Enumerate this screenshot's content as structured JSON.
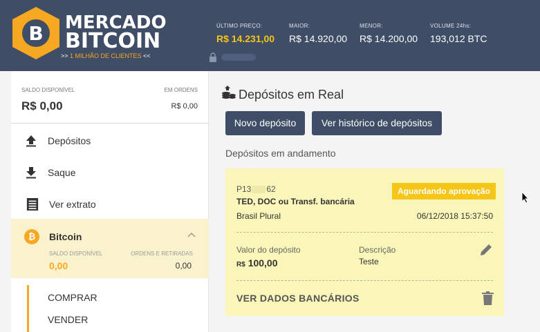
{
  "header": {
    "brand_line1": "MERCADO",
    "brand_line2": "BITCOIN",
    "tagline_prefix": ">> ",
    "tagline_highlight": "1 MILHÃO DE CLIENTES",
    "tagline_suffix": " <<",
    "stats": [
      {
        "label": "ÚLTIMO PREÇO:",
        "value": "R$ 14.231,00"
      },
      {
        "label": "MAIOR:",
        "value": "R$ 14.920,00"
      },
      {
        "label": "MENOR:",
        "value": "R$ 14.200,00"
      },
      {
        "label": "VOLUME 24hs:",
        "value": "193,012 BTC"
      }
    ]
  },
  "sidebar": {
    "balance_label": "SALDO DISPONÍVEL",
    "balance_value": "R$ 0,00",
    "orders_label": "EM ORDENS",
    "orders_value": "R$ 0,00",
    "menu": [
      {
        "label": "Depósitos",
        "icon": "upload-icon"
      },
      {
        "label": "Saque",
        "icon": "download-icon"
      },
      {
        "label": "Ver extrato",
        "icon": "statement-icon"
      }
    ],
    "bitcoin": {
      "name": "Bitcoin",
      "available_label": "SALDO DISPONÍVEL",
      "available_value": "0,00",
      "orders_label": "ORDENS E RETIRADAS",
      "orders_value": "0,00"
    },
    "sub_items": [
      "COMPRAR",
      "VENDER"
    ]
  },
  "main": {
    "title": "Depósitos em Real",
    "new_deposit_button": "Novo depósito",
    "history_button": "Ver histórico de depósitos",
    "in_progress_label": "Depósitos em andamento",
    "deposit": {
      "code_prefix": "P13",
      "code_suffix": "62",
      "status": "Aguardando aprovação",
      "method": "TED, DOC ou Transf. bancária",
      "bank": "Brasil Plural",
      "datetime": "06/12/2018 15:37:50",
      "value_label": "Valor do depósito",
      "currency": "R$",
      "value": "100,00",
      "description_label": "Descrição",
      "description": "Teste",
      "bank_data_link": "VER DADOS BANCÁRIOS"
    }
  },
  "colors": {
    "header_bg": "#3f4d66",
    "accent_orange": "#f7a823",
    "price_gold": "#f5c518",
    "card_bg": "#faf5b8",
    "badge_bg": "#f5c518"
  }
}
